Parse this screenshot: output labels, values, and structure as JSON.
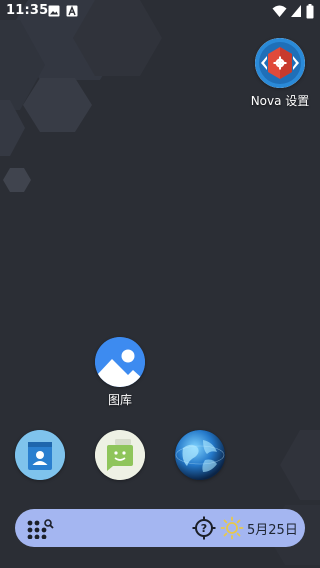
{
  "status_bar": {
    "time": "11:35"
  },
  "apps": {
    "nova_settings": {
      "label": "Nova 设置"
    },
    "gallery": {
      "label": "图库"
    }
  },
  "dock": {
    "date": "5月25日"
  },
  "colors": {
    "background": "#2b2e35",
    "dock_bar": "#a4b6f1",
    "nova_red": "#e04a3b",
    "nova_blue": "#2a8ad8",
    "gallery_blue": "#3d8bf0",
    "contacts_blue": "#5fb1e6",
    "messages_green": "#9bd06d"
  },
  "icons": {
    "status_left": [
      "image-icon",
      "font-icon"
    ],
    "status_right": [
      "wifi-icon",
      "signal-icon",
      "battery-icon"
    ],
    "dock": [
      "app-drawer-dots-icon",
      "search-icon",
      "weather-help-icon",
      "sun-icon"
    ]
  }
}
